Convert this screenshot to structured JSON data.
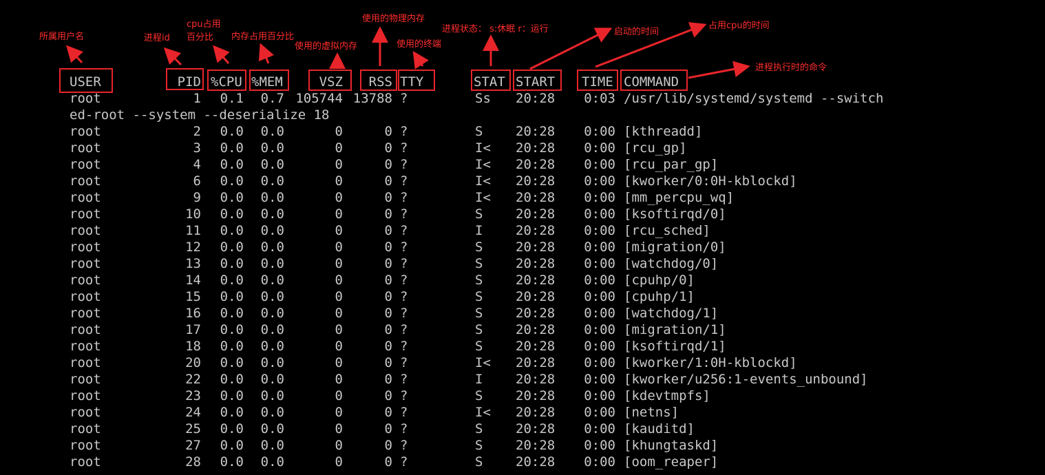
{
  "headers": {
    "user": "USER",
    "pid": "PID",
    "cpu": "%CPU",
    "mem": "%MEM",
    "vsz": "VSZ",
    "rss": "RSS",
    "tty": "TTY",
    "stat": "STAT",
    "start": "START",
    "time": "TIME",
    "command": "COMMAND"
  },
  "first_row": {
    "user": "root",
    "pid": "1",
    "cpu": "0.1",
    "mem": "0.7",
    "vsz": "105744",
    "rss": "13788",
    "tty": "?",
    "stat": "Ss",
    "start": "20:28",
    "time": "0:03",
    "command": "/usr/lib/systemd/systemd --switch",
    "continuation": "ed-root --system --deserialize 18"
  },
  "rows": [
    {
      "user": "root",
      "pid": "2",
      "cpu": "0.0",
      "mem": "0.0",
      "vsz": "0",
      "rss": "0",
      "tty": "?",
      "stat": "S",
      "start": "20:28",
      "time": "0:00",
      "command": "[kthreadd]"
    },
    {
      "user": "root",
      "pid": "3",
      "cpu": "0.0",
      "mem": "0.0",
      "vsz": "0",
      "rss": "0",
      "tty": "?",
      "stat": "I<",
      "start": "20:28",
      "time": "0:00",
      "command": "[rcu_gp]"
    },
    {
      "user": "root",
      "pid": "4",
      "cpu": "0.0",
      "mem": "0.0",
      "vsz": "0",
      "rss": "0",
      "tty": "?",
      "stat": "I<",
      "start": "20:28",
      "time": "0:00",
      "command": "[rcu_par_gp]"
    },
    {
      "user": "root",
      "pid": "6",
      "cpu": "0.0",
      "mem": "0.0",
      "vsz": "0",
      "rss": "0",
      "tty": "?",
      "stat": "I<",
      "start": "20:28",
      "time": "0:00",
      "command": "[kworker/0:0H-kblockd]"
    },
    {
      "user": "root",
      "pid": "9",
      "cpu": "0.0",
      "mem": "0.0",
      "vsz": "0",
      "rss": "0",
      "tty": "?",
      "stat": "I<",
      "start": "20:28",
      "time": "0:00",
      "command": "[mm_percpu_wq]"
    },
    {
      "user": "root",
      "pid": "10",
      "cpu": "0.0",
      "mem": "0.0",
      "vsz": "0",
      "rss": "0",
      "tty": "?",
      "stat": "S",
      "start": "20:28",
      "time": "0:00",
      "command": "[ksoftirqd/0]"
    },
    {
      "user": "root",
      "pid": "11",
      "cpu": "0.0",
      "mem": "0.0",
      "vsz": "0",
      "rss": "0",
      "tty": "?",
      "stat": "I",
      "start": "20:28",
      "time": "0:00",
      "command": "[rcu_sched]"
    },
    {
      "user": "root",
      "pid": "12",
      "cpu": "0.0",
      "mem": "0.0",
      "vsz": "0",
      "rss": "0",
      "tty": "?",
      "stat": "S",
      "start": "20:28",
      "time": "0:00",
      "command": "[migration/0]"
    },
    {
      "user": "root",
      "pid": "13",
      "cpu": "0.0",
      "mem": "0.0",
      "vsz": "0",
      "rss": "0",
      "tty": "?",
      "stat": "S",
      "start": "20:28",
      "time": "0:00",
      "command": "[watchdog/0]"
    },
    {
      "user": "root",
      "pid": "14",
      "cpu": "0.0",
      "mem": "0.0",
      "vsz": "0",
      "rss": "0",
      "tty": "?",
      "stat": "S",
      "start": "20:28",
      "time": "0:00",
      "command": "[cpuhp/0]"
    },
    {
      "user": "root",
      "pid": "15",
      "cpu": "0.0",
      "mem": "0.0",
      "vsz": "0",
      "rss": "0",
      "tty": "?",
      "stat": "S",
      "start": "20:28",
      "time": "0:00",
      "command": "[cpuhp/1]"
    },
    {
      "user": "root",
      "pid": "16",
      "cpu": "0.0",
      "mem": "0.0",
      "vsz": "0",
      "rss": "0",
      "tty": "?",
      "stat": "S",
      "start": "20:28",
      "time": "0:00",
      "command": "[watchdog/1]"
    },
    {
      "user": "root",
      "pid": "17",
      "cpu": "0.0",
      "mem": "0.0",
      "vsz": "0",
      "rss": "0",
      "tty": "?",
      "stat": "S",
      "start": "20:28",
      "time": "0:00",
      "command": "[migration/1]"
    },
    {
      "user": "root",
      "pid": "18",
      "cpu": "0.0",
      "mem": "0.0",
      "vsz": "0",
      "rss": "0",
      "tty": "?",
      "stat": "S",
      "start": "20:28",
      "time": "0:00",
      "command": "[ksoftirqd/1]"
    },
    {
      "user": "root",
      "pid": "20",
      "cpu": "0.0",
      "mem": "0.0",
      "vsz": "0",
      "rss": "0",
      "tty": "?",
      "stat": "I<",
      "start": "20:28",
      "time": "0:00",
      "command": "[kworker/1:0H-kblockd]"
    },
    {
      "user": "root",
      "pid": "22",
      "cpu": "0.0",
      "mem": "0.0",
      "vsz": "0",
      "rss": "0",
      "tty": "?",
      "stat": "I",
      "start": "20:28",
      "time": "0:00",
      "command": "[kworker/u256:1-events_unbound]"
    },
    {
      "user": "root",
      "pid": "23",
      "cpu": "0.0",
      "mem": "0.0",
      "vsz": "0",
      "rss": "0",
      "tty": "?",
      "stat": "S",
      "start": "20:28",
      "time": "0:00",
      "command": "[kdevtmpfs]"
    },
    {
      "user": "root",
      "pid": "24",
      "cpu": "0.0",
      "mem": "0.0",
      "vsz": "0",
      "rss": "0",
      "tty": "?",
      "stat": "I<",
      "start": "20:28",
      "time": "0:00",
      "command": "[netns]"
    },
    {
      "user": "root",
      "pid": "25",
      "cpu": "0.0",
      "mem": "0.0",
      "vsz": "0",
      "rss": "0",
      "tty": "?",
      "stat": "S",
      "start": "20:28",
      "time": "0:00",
      "command": "[kauditd]"
    },
    {
      "user": "root",
      "pid": "27",
      "cpu": "0.0",
      "mem": "0.0",
      "vsz": "0",
      "rss": "0",
      "tty": "?",
      "stat": "S",
      "start": "20:28",
      "time": "0:00",
      "command": "[khungtaskd]"
    },
    {
      "user": "root",
      "pid": "28",
      "cpu": "0.0",
      "mem": "0.0",
      "vsz": "0",
      "rss": "0",
      "tty": "?",
      "stat": "S",
      "start": "20:28",
      "time": "0:00",
      "command": "[oom_reaper]"
    }
  ],
  "annotations": {
    "user": "所属用户名",
    "pid": "进程id",
    "cpu_line1": "cpu占用",
    "cpu_line2": "百分比",
    "mem": "内存占用百分比",
    "vsz": "使用的虚拟内存",
    "rss": "使用的物理内存",
    "tty": "使用的终端",
    "stat": "进程状态： s:休眠 r：运行",
    "start": "启动的时间",
    "time": "占用cpu的时间",
    "command": "进程执行时的命令"
  },
  "colors": {
    "background": "#000000",
    "terminal_text": "#c8c8c8",
    "annotation": "#e8252a"
  }
}
